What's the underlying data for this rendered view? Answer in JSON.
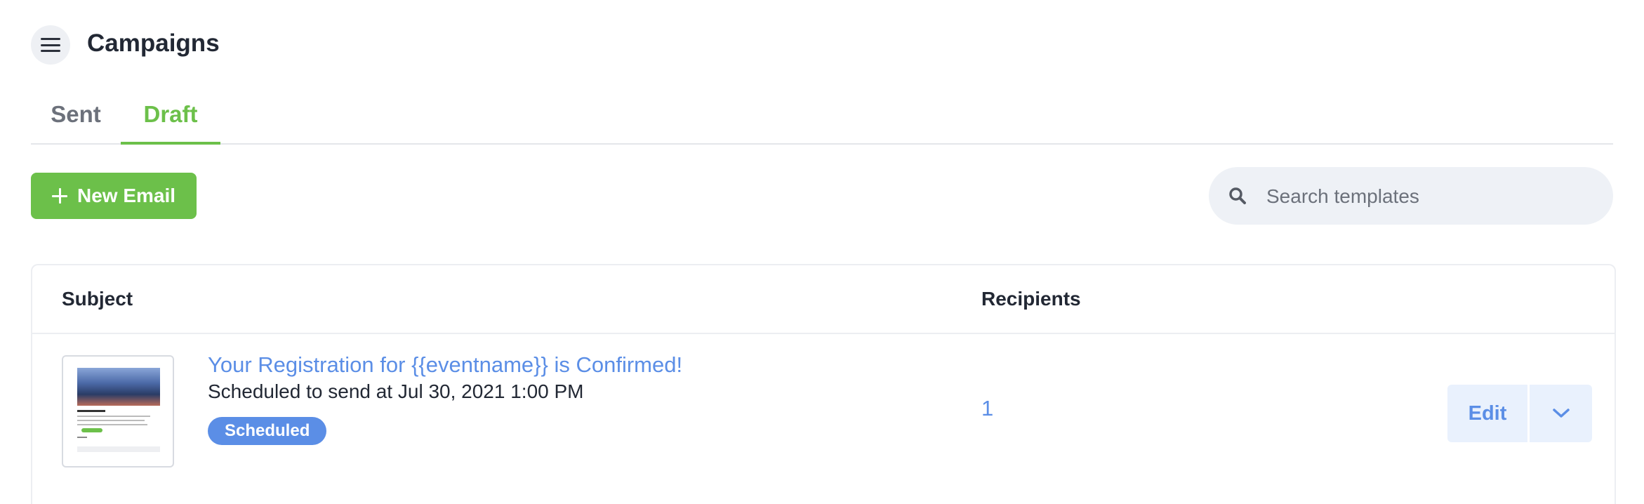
{
  "header": {
    "title": "Campaigns",
    "menu_icon": "hamburger-menu-icon"
  },
  "tabs": [
    {
      "label": "Sent",
      "active": false
    },
    {
      "label": "Draft",
      "active": true
    }
  ],
  "toolbar": {
    "new_email_label": "New Email",
    "new_email_icon": "plus-icon",
    "search_placeholder": "Search templates",
    "search_value": "",
    "search_icon": "search-icon"
  },
  "table": {
    "columns": [
      "Subject",
      "Recipients"
    ],
    "rows": [
      {
        "subject": "Your Registration for {{eventname}} is Confirmed!",
        "schedule": "Scheduled to send at Jul 30, 2021 1:00 PM",
        "status": "Scheduled",
        "recipients": "1",
        "edit_label": "Edit",
        "dropdown_icon": "chevron-down-icon"
      }
    ]
  },
  "colors": {
    "accent_green": "#6cc04a",
    "link_blue": "#5b8ee6",
    "badge_blue": "#5b8ee6",
    "edit_bg": "#e9f1fd",
    "search_bg": "#eef1f6"
  }
}
